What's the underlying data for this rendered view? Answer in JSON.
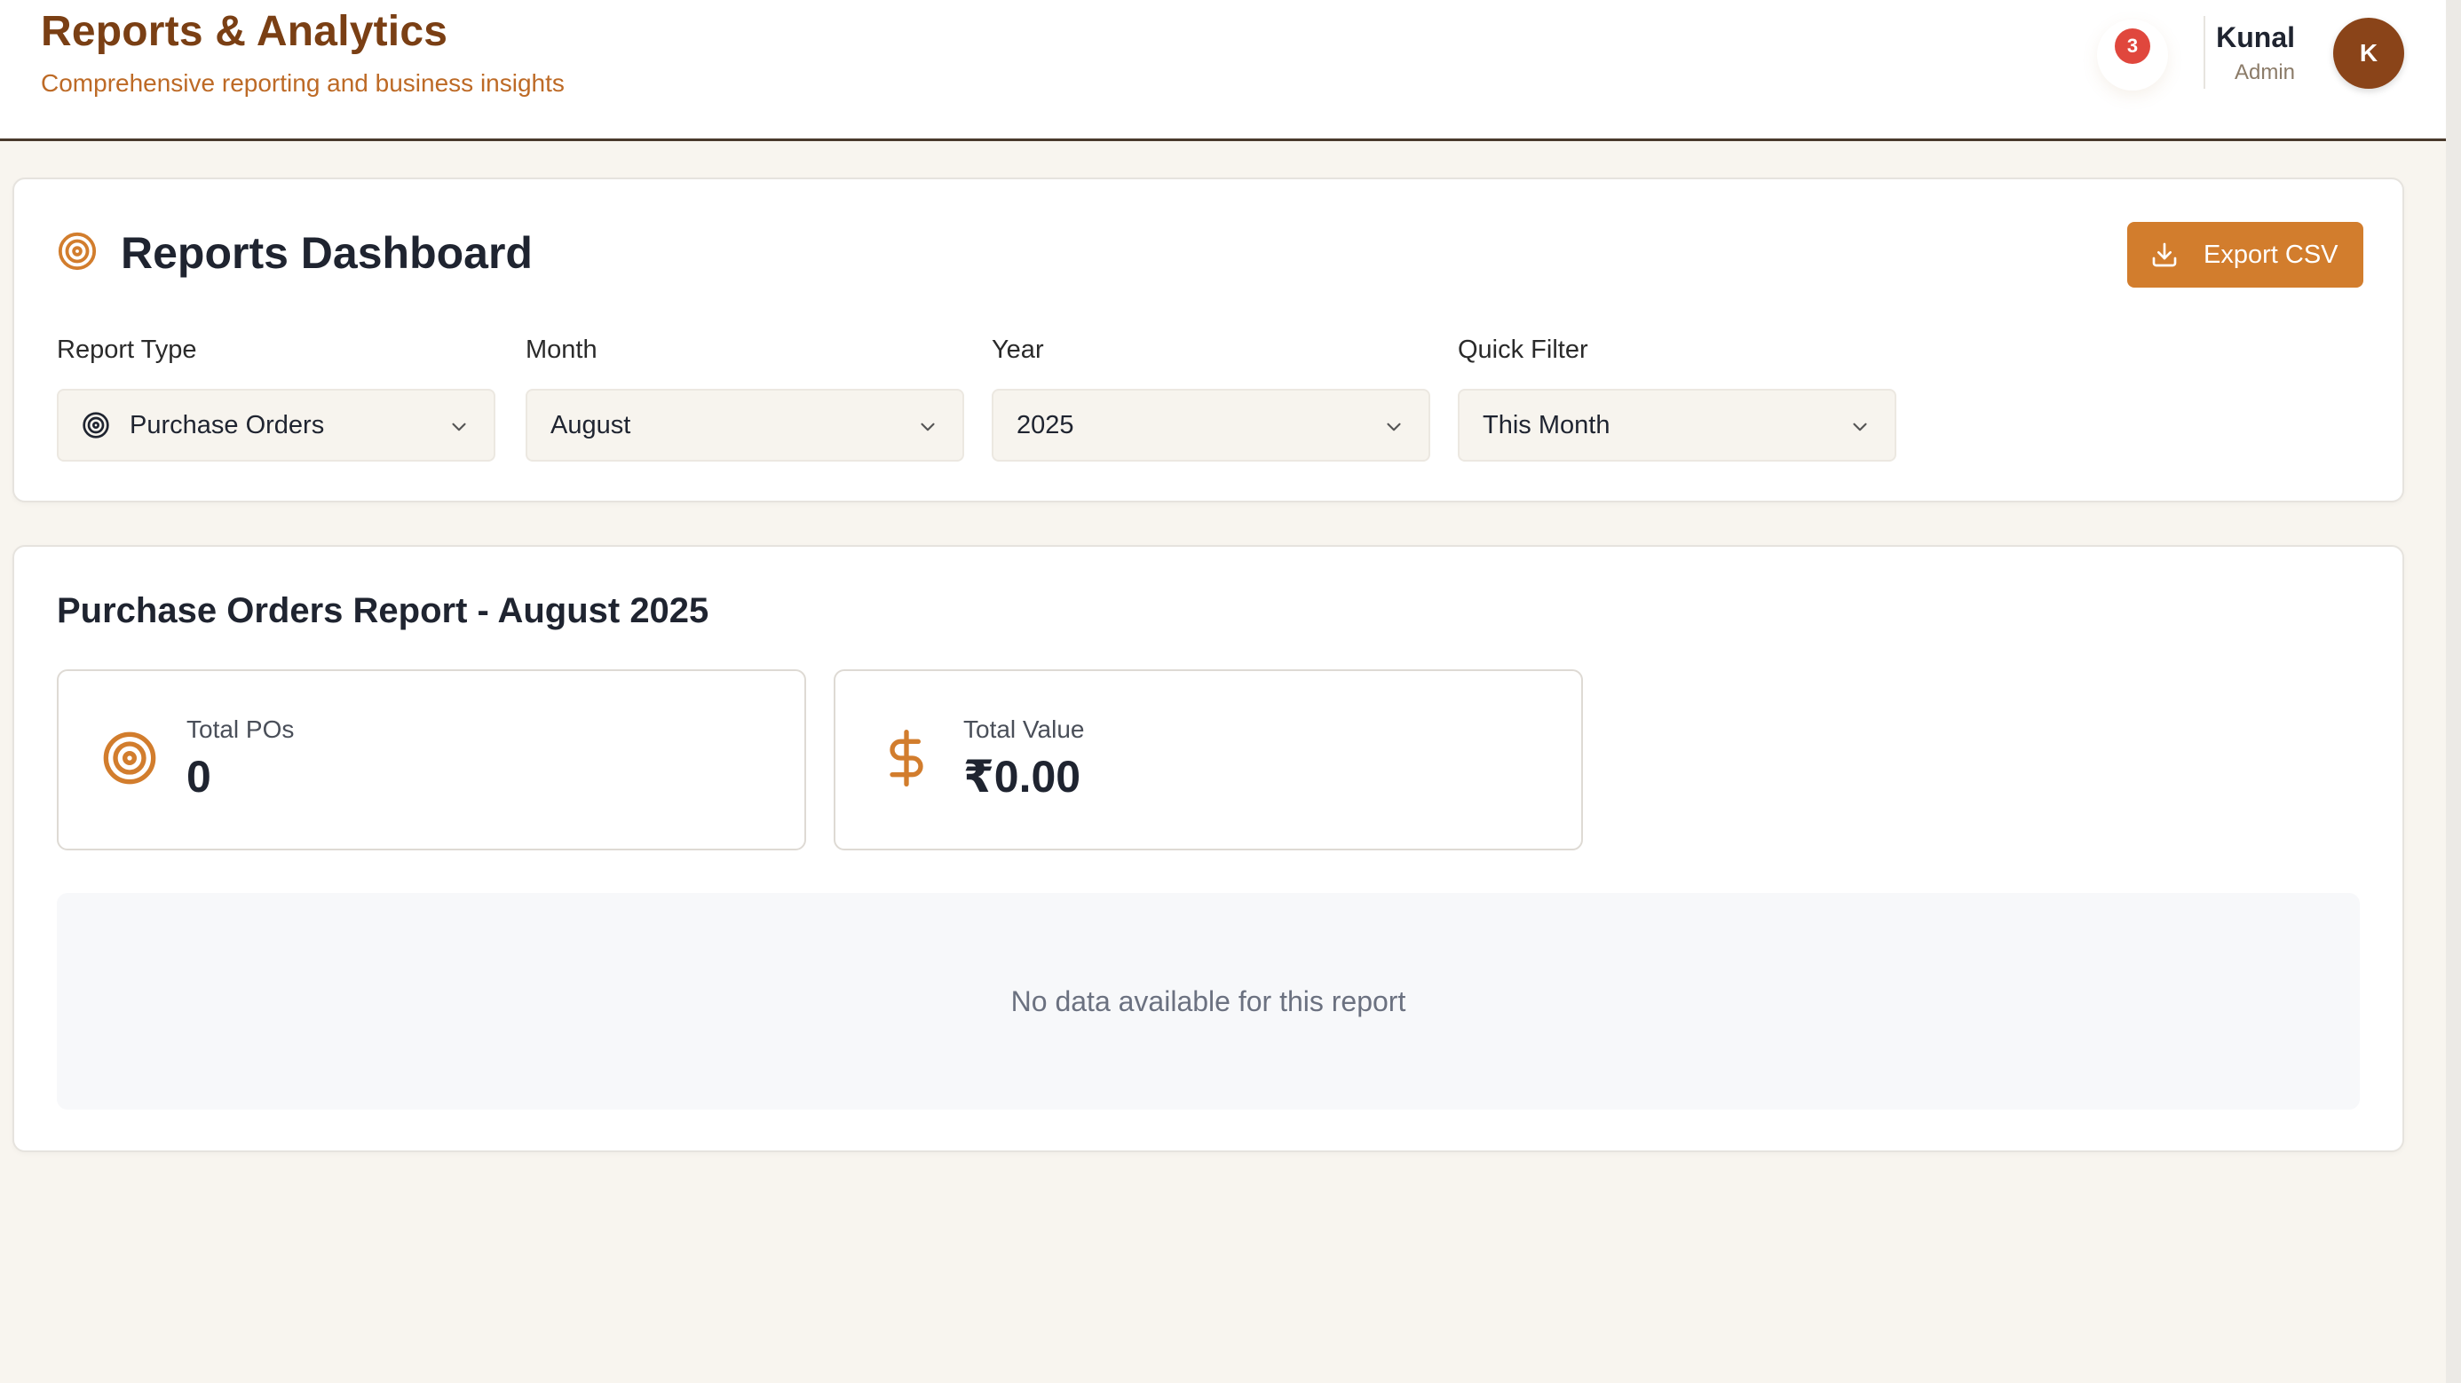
{
  "header": {
    "title": "Reports & Analytics",
    "subtitle": "Comprehensive reporting and business insights",
    "notification_count": "3",
    "user": {
      "name": "Kunal",
      "role": "Admin",
      "initial": "K"
    }
  },
  "dashboard": {
    "title": "Reports Dashboard",
    "export_label": "Export CSV",
    "filters": [
      {
        "label": "Report Type",
        "value": "Purchase Orders",
        "icon": "target-icon"
      },
      {
        "label": "Month",
        "value": "August"
      },
      {
        "label": "Year",
        "value": "2025"
      },
      {
        "label": "Quick Filter",
        "value": "This Month"
      }
    ]
  },
  "report": {
    "title": "Purchase Orders Report - August 2025",
    "stats": [
      {
        "label": "Total POs",
        "value": "0",
        "icon": "target-icon"
      },
      {
        "label": "Total Value",
        "value": "₹0.00",
        "icon": "dollar-icon"
      }
    ],
    "empty_message": "No data available for this report"
  },
  "colors": {
    "brand_dark": "#7a3f14",
    "brand_accent": "#d27d2d",
    "badge": "#e0473d",
    "background": "#f8f5ef"
  }
}
